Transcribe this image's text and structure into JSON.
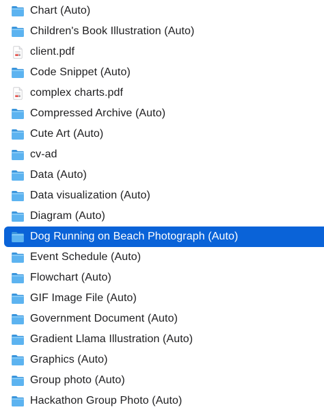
{
  "finder_list": {
    "accent_color": "#0a63d8",
    "folder_color": "#4aa8ec",
    "items": [
      {
        "label": "Chart (Auto)",
        "icon": "folder-icon",
        "selected": false
      },
      {
        "label": "Children's Book Illustration (Auto)",
        "icon": "folder-icon",
        "selected": false
      },
      {
        "label": "client.pdf",
        "icon": "pdf-file-icon",
        "selected": false
      },
      {
        "label": "Code Snippet (Auto)",
        "icon": "folder-icon",
        "selected": false
      },
      {
        "label": "complex charts.pdf",
        "icon": "pdf-file-icon",
        "selected": false
      },
      {
        "label": "Compressed Archive (Auto)",
        "icon": "folder-icon",
        "selected": false
      },
      {
        "label": "Cute Art (Auto)",
        "icon": "folder-icon",
        "selected": false
      },
      {
        "label": "cv-ad",
        "icon": "folder-icon",
        "selected": false
      },
      {
        "label": "Data (Auto)",
        "icon": "folder-icon",
        "selected": false
      },
      {
        "label": "Data visualization (Auto)",
        "icon": "folder-icon",
        "selected": false
      },
      {
        "label": "Diagram (Auto)",
        "icon": "folder-icon",
        "selected": false
      },
      {
        "label": "Dog Running on Beach Photograph (Auto)",
        "icon": "folder-icon",
        "selected": true
      },
      {
        "label": "Event Schedule (Auto)",
        "icon": "folder-icon",
        "selected": false
      },
      {
        "label": "Flowchart (Auto)",
        "icon": "folder-icon",
        "selected": false
      },
      {
        "label": "GIF Image File (Auto)",
        "icon": "folder-icon",
        "selected": false
      },
      {
        "label": "Government Document (Auto)",
        "icon": "folder-icon",
        "selected": false
      },
      {
        "label": "Gradient Llama Illustration (Auto)",
        "icon": "folder-icon",
        "selected": false
      },
      {
        "label": "Graphics (Auto)",
        "icon": "folder-icon",
        "selected": false
      },
      {
        "label": "Group photo (Auto)",
        "icon": "folder-icon",
        "selected": false
      },
      {
        "label": "Hackathon Group Photo (Auto)",
        "icon": "folder-icon",
        "selected": false
      }
    ]
  }
}
